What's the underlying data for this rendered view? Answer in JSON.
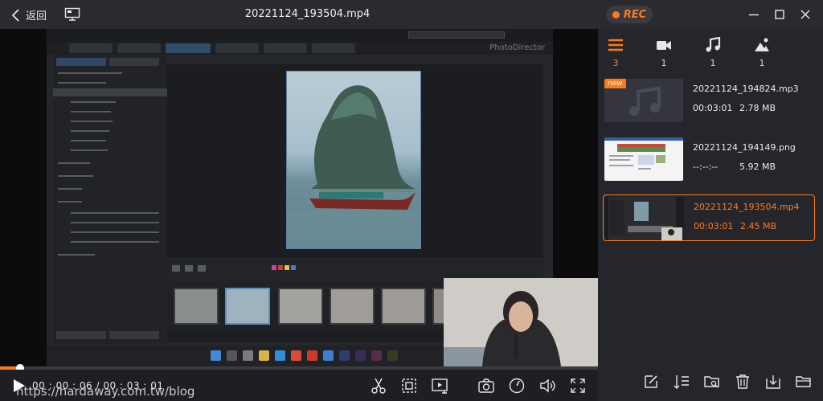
{
  "titlebar": {
    "back_label": "返回",
    "file_title": "20221124_193504.mp4",
    "rec_label": "REC",
    "icons": [
      "chevron-left-icon",
      "screen-icon",
      "minimize-icon",
      "maximize-icon",
      "close-icon"
    ]
  },
  "player": {
    "progress": 0.0331,
    "timecode": "00 : 00 : 06 / 00 : 03 : 01",
    "embedded_app_brand": "PhotoDirector",
    "controls": [
      "play-icon",
      "trim-icon",
      "crop-icon",
      "video-export-icon",
      "snapshot-icon",
      "speed-icon",
      "volume-icon",
      "fullscreen-icon"
    ]
  },
  "watermark": "https://hardaway.com.tw/blog",
  "sidebar": {
    "filters": [
      {
        "icon": "list-icon",
        "count": "3",
        "active": true
      },
      {
        "icon": "video-icon",
        "count": "1",
        "active": false
      },
      {
        "icon": "music-icon",
        "count": "1",
        "active": false
      },
      {
        "icon": "image-icon",
        "count": "1",
        "active": false
      }
    ],
    "files": [
      {
        "name": "20221124_194824.mp3",
        "duration": "00:03:01",
        "size": "2.78 MB",
        "badge": "new",
        "type": "audio"
      },
      {
        "name": "20221124_194149.png",
        "duration": "--:--:--",
        "size": "5.92 MB",
        "badge": "",
        "type": "image"
      },
      {
        "name": "20221124_193504.mp4",
        "duration": "00:03:01",
        "size": "2.45 MB",
        "badge": "",
        "type": "video",
        "selected": true
      }
    ],
    "tools": [
      "edit-icon",
      "sort-icon",
      "folder-search-icon",
      "delete-icon",
      "export-icon",
      "folder-open-icon"
    ]
  },
  "colors": {
    "accent": "#ff7a1a",
    "background": "#1e1f24",
    "sidebar": "#25262c"
  }
}
